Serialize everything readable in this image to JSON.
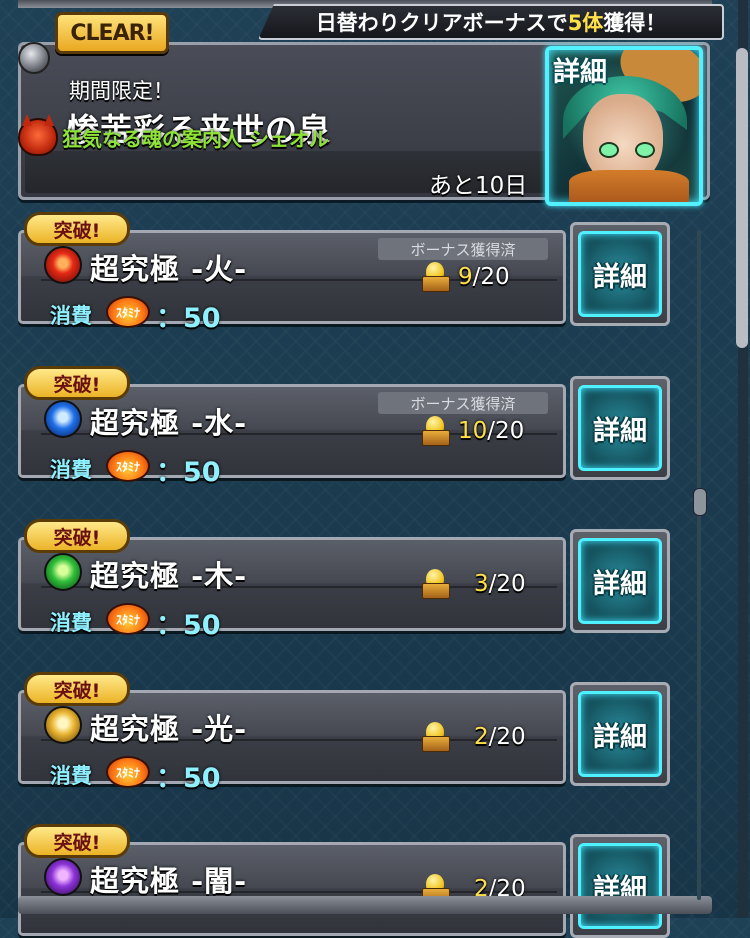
{
  "event": {
    "bonus_prefix": "日替わりクリアボーナスで",
    "bonus_highlight": "5体",
    "bonus_suffix": "獲得！",
    "clear_badge": "CLEAR!",
    "subtitle": "期間限定！",
    "title": "惨苦彩る来世の泉",
    "boss_name": "狂気なる魂の案内人 シェオル",
    "remaining": "あと10日",
    "detail_label": "詳細"
  },
  "quests": [
    {
      "badge": "突破!",
      "name": "超究極 ‐火‐",
      "element": "fire",
      "bonus_tag": "ボーナス獲得済",
      "count_current": "9",
      "count_total": "/20",
      "cost_label": "消費",
      "stamina_label": "ｽﾀﾐﾅ",
      "cost_value": "：50",
      "detail_label": "詳細"
    },
    {
      "badge": "突破!",
      "name": "超究極 ‐水‐",
      "element": "water",
      "bonus_tag": "ボーナス獲得済",
      "count_current": "10",
      "count_total": "/20",
      "cost_label": "消費",
      "stamina_label": "ｽﾀﾐﾅ",
      "cost_value": "：50",
      "detail_label": "詳細"
    },
    {
      "badge": "突破!",
      "name": "超究極 ‐木‐",
      "element": "wood",
      "bonus_tag": "",
      "count_current": "3",
      "count_total": "/20",
      "cost_label": "消費",
      "stamina_label": "ｽﾀﾐﾅ",
      "cost_value": "：50",
      "detail_label": "詳細"
    },
    {
      "badge": "突破!",
      "name": "超究極 ‐光‐",
      "element": "light",
      "bonus_tag": "",
      "count_current": "2",
      "count_total": "/20",
      "cost_label": "消費",
      "stamina_label": "ｽﾀﾐﾅ",
      "cost_value": "：50",
      "detail_label": "詳細"
    },
    {
      "badge": "突破!",
      "name": "超究極 ‐闇‐",
      "element": "dark",
      "bonus_tag": "",
      "count_current": "2",
      "count_total": "/20",
      "cost_label": "",
      "stamina_label": "",
      "cost_value": "",
      "detail_label": "詳細"
    }
  ],
  "colors": {
    "highlight": "#ffe048",
    "boss_name": "#8de336",
    "cost": "#8ff0ff",
    "cyan_frame": "#4ff0ff"
  },
  "icons": {
    "boss": "demon-face-icon",
    "reward": "egg-box-icon",
    "stamina": "stamina-flame-icon"
  }
}
